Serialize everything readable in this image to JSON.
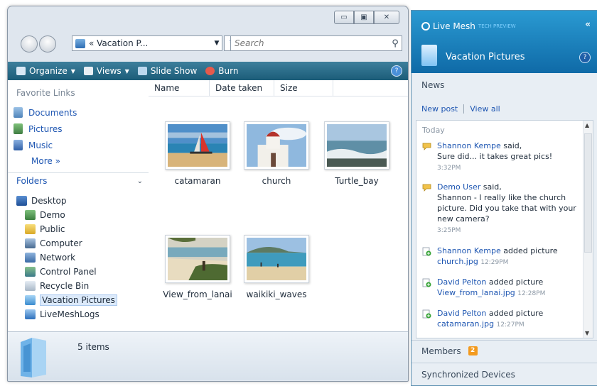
{
  "explorer": {
    "caption_buttons": [
      "▭",
      "▣",
      "✕"
    ],
    "address_path": "« Vacation P...",
    "search_placeholder": "Search",
    "toolbar": {
      "organize": "Organize",
      "views": "Views",
      "slideshow": "Slide Show",
      "burn": "Burn",
      "help": "?"
    },
    "nav": {
      "favorites_heading": "Favorite Links",
      "favorites": [
        "Documents",
        "Pictures",
        "Music"
      ],
      "more": "More »",
      "folders_label": "Folders",
      "tree": [
        "Desktop",
        "Demo",
        "Public",
        "Computer",
        "Network",
        "Control Panel",
        "Recycle Bin",
        "Vacation Pictures",
        "LiveMeshLogs"
      ],
      "selected": "Vacation Pictures"
    },
    "columns": [
      "Name",
      "Date taken",
      "Size"
    ],
    "files": [
      "catamaran",
      "church",
      "Turtle_bay",
      "View_from_lanai",
      "waikiki_waves"
    ],
    "status_count": "5 items"
  },
  "mesh": {
    "product": "Live Mesh",
    "tech_preview": "TECH PREVIEW",
    "collapse": "«",
    "folder_title": "Vacation Pictures",
    "help": "?",
    "news_header": "News",
    "new_post": "New post",
    "view_all": "View all",
    "day": "Today",
    "feed": [
      {
        "name": "Shannon Kempe",
        "action": "said,",
        "text": "Sure did... it takes great pics!",
        "link": "",
        "time": "3:32PM"
      },
      {
        "name": "Demo User",
        "action": "said,",
        "text": "Shannon - I really like the church picture. Did you take that with your new camera?",
        "link": "",
        "time": "3:25PM"
      },
      {
        "name": "Shannon Kempe",
        "action": "added picture",
        "text": "",
        "link": "church.jpg",
        "time": "12:29PM"
      },
      {
        "name": "David Pelton",
        "action": "added picture",
        "text": "",
        "link": "View_from_lanai.jpg",
        "time": "12:28PM"
      },
      {
        "name": "David Pelton",
        "action": "added picture",
        "text": "",
        "link": "catamaran.jpg",
        "time": "12:27PM"
      }
    ],
    "members_label": "Members",
    "members_count": "2",
    "sync_label": "Synchronized Devices"
  },
  "colors": {
    "toolbar": "#1b5c78",
    "mesh_header": "#0f6aa7",
    "link": "#1e56b2",
    "members_badge": "#f39a1e"
  }
}
